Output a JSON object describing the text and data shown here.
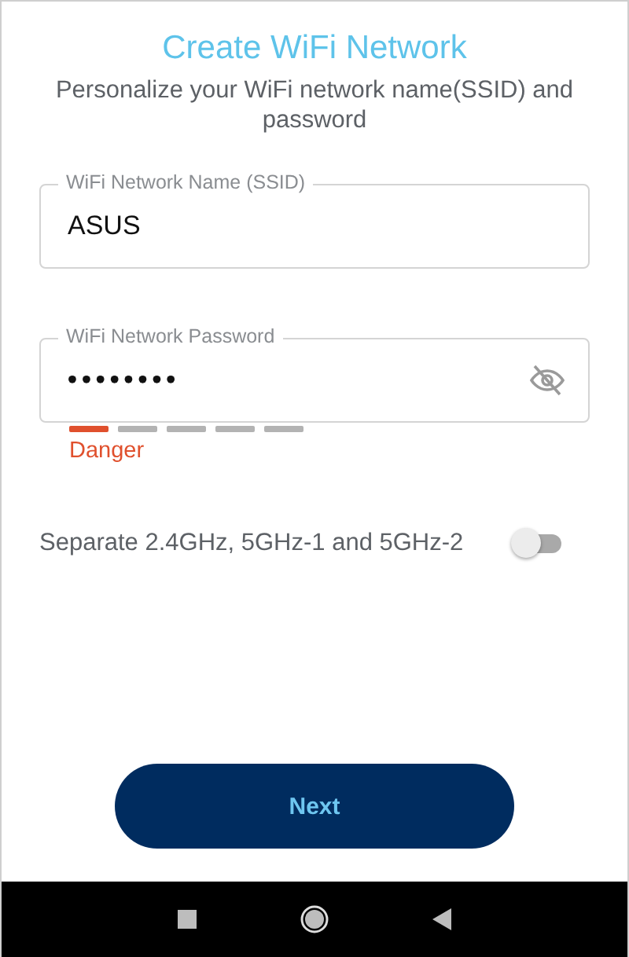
{
  "title": "Create WiFi Network",
  "subtitle": "Personalize your WiFi network name(SSID) and password",
  "fields": [
    {
      "kind": "text",
      "label": "WiFi Network Name (SSID)",
      "value": "ASUS"
    },
    {
      "kind": "password",
      "label": "WiFi Network Password",
      "value": "••••••••",
      "revealed": false,
      "strength": {
        "segments": [
          {
            "filled": true
          },
          {
            "filled": false
          },
          {
            "filled": false
          },
          {
            "filled": false
          },
          {
            "filled": false
          }
        ],
        "label": "Danger"
      }
    }
  ],
  "separate_bands": {
    "label": "Separate 2.4GHz, 5GHz-1 and 5GHz-2",
    "on": false
  },
  "next_button": "Next"
}
